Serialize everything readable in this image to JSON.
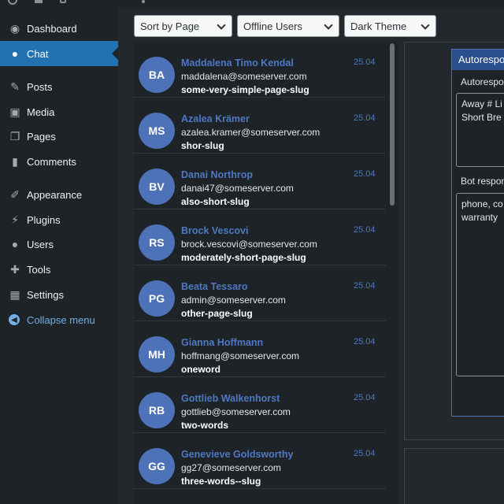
{
  "sidebar": {
    "items": [
      {
        "label": "Dashboard",
        "icon": "dashboard-icon",
        "glyph": "◉"
      },
      {
        "label": "Chat",
        "icon": "chat-user-icon",
        "glyph": "●"
      },
      {
        "label": "Posts",
        "icon": "pin-icon",
        "glyph": "✎"
      },
      {
        "label": "Media",
        "icon": "media-icon",
        "glyph": "▣"
      },
      {
        "label": "Pages",
        "icon": "pages-icon",
        "glyph": "❐"
      },
      {
        "label": "Comments",
        "icon": "comments-icon",
        "glyph": "▮"
      },
      {
        "label": "Appearance",
        "icon": "brush-icon",
        "glyph": "✐"
      },
      {
        "label": "Plugins",
        "icon": "plug-icon",
        "glyph": "⚡"
      },
      {
        "label": "Users",
        "icon": "users-icon",
        "glyph": "●"
      },
      {
        "label": "Tools",
        "icon": "wrench-icon",
        "glyph": "✚"
      },
      {
        "label": "Settings",
        "icon": "settings-icon",
        "glyph": "▦"
      },
      {
        "label": "Collapse menu",
        "icon": "collapse-icon",
        "glyph": "◀"
      }
    ]
  },
  "filters": {
    "sort": "Sort by Page",
    "users": "Offline Users",
    "theme": "Dark Theme"
  },
  "chats": [
    {
      "initials": "BA",
      "name": "Maddalena Timo Kendal",
      "email": "maddalena@someserver.com",
      "slug": "some-very-simple-page-slug",
      "date": "25.04"
    },
    {
      "initials": "MS",
      "name": "Azalea Krämer",
      "email": "azalea.kramer@someserver.com",
      "slug": "shor-slug",
      "date": "25.04"
    },
    {
      "initials": "BV",
      "name": "Danai Northrop",
      "email": "danai47@someserver.com",
      "slug": "also-short-slug",
      "date": "25.04"
    },
    {
      "initials": "RS",
      "name": "Brock Vescovi",
      "email": "brock.vescovi@someserver.com",
      "slug": "moderately-short-page-slug",
      "date": "25.04"
    },
    {
      "initials": "PG",
      "name": "Beata Tessaro",
      "email": "admin@someserver.com",
      "slug": "other-page-slug",
      "date": "25.04"
    },
    {
      "initials": "MH",
      "name": "Gianna Hoffmann",
      "email": "hoffmang@someserver.com",
      "slug": "oneword",
      "date": "25.04"
    },
    {
      "initials": "RB",
      "name": "Gottlieb Walkenhorst",
      "email": "gottlieb@someserver.com",
      "slug": "two-words",
      "date": "25.04"
    },
    {
      "initials": "GG",
      "name": "Genevieve Goldsworthy",
      "email": "gg27@someserver.com",
      "slug": "three-words--slug",
      "date": "25.04"
    }
  ],
  "autoresponder": {
    "title": "Autorespo",
    "field1_label": "Autorespo",
    "field1_value": "Away # Li\nShort Bre",
    "field2_label": "Bot respon",
    "field2_value": "phone, co\nwarranty"
  },
  "colors": {
    "accent": "#2271b1",
    "avatar": "#4e72b8",
    "name": "#4f78c2"
  }
}
